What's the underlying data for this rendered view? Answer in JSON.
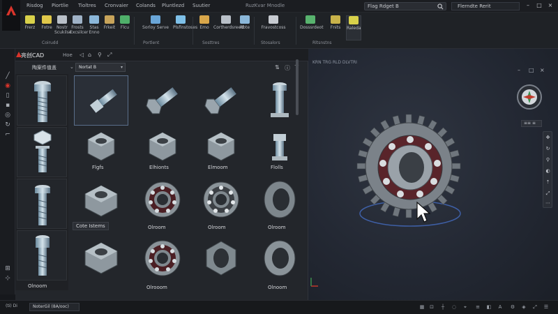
{
  "app": {
    "title_fragment": "RuzKvar Mnodle"
  },
  "ribbon_tabs": [
    "Risdog",
    "Piortlie",
    "Tioltres",
    "Cronvaier",
    "Colands",
    "Pluntlezd",
    "Suutier"
  ],
  "search": {
    "value": "Flag Rdget B"
  },
  "user": {
    "name": "Flerndte Rerit"
  },
  "ribbon_tools": [
    {
      "label": "Frerz",
      "color": "#d8d14a"
    },
    {
      "label": "Fotre",
      "color": "#e0c84a"
    },
    {
      "label": "Nostr Scukilse",
      "color": "#b9c0c8"
    },
    {
      "label": "Frosts Excsilcer",
      "color": "#9fb2c6"
    },
    {
      "label": "Stas Enno",
      "color": "#8bb7d9"
    },
    {
      "label": "Frkeit",
      "color": "#c8a45a"
    },
    {
      "label": "Flcu",
      "color": "#4fb06a"
    },
    {
      "label": "Sorloy Serve",
      "color": "#6aa6d8"
    },
    {
      "label": "Plsfinstoses",
      "color": "#7ec0e8"
    },
    {
      "label": "Emo",
      "color": "#d8a64a"
    },
    {
      "label": "Cortherdsreed",
      "color": "#b9c0c8"
    },
    {
      "label": "Rbte",
      "color": "#8bb7d9"
    },
    {
      "label": "Fravostcoss",
      "color": "#c7cbd1"
    },
    {
      "label": "Dosssrdeot",
      "color": "#58b36e"
    },
    {
      "label": "Fnits",
      "color": "#c8b24a"
    },
    {
      "label": "Raleda",
      "color": "#d8d14a"
    }
  ],
  "ribbon_panels": [
    "Coirudd",
    "Portlent",
    "Sosttres",
    "Stosalors",
    "Rltsnstns"
  ],
  "library": {
    "title": "亮创CAD",
    "title_suffix": "Hoe",
    "category": "陶案件值盖",
    "filter": "Nortat B",
    "labels": [
      "Flgfs",
      "Elhionts",
      "Elmoom",
      "Flolls",
      "Cote Istems",
      "Olroom",
      "Olroom",
      "Olroom",
      "Olnoom",
      "Olrooom",
      "Olnoom"
    ]
  },
  "viewport": {
    "title": "KRN TRG RLD DLVTRI",
    "cube_label": "≡≡ ≡"
  },
  "status": {
    "mode": "(ti) Di",
    "command": "NoterGil (8A/ooc)"
  },
  "colors": {
    "accent": "#d9342b",
    "selection": "#5a6f8a"
  }
}
